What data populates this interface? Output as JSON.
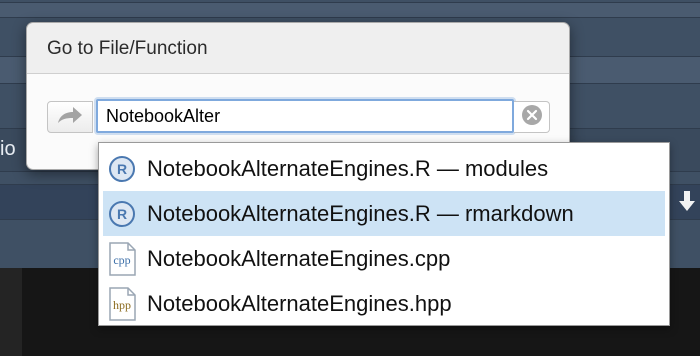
{
  "background": {
    "partial_text": "io",
    "down_arrow_icon": "arrow-down-icon"
  },
  "dialog": {
    "title": "Go to File/Function",
    "go_icon": "forward-arrow-icon",
    "clear_icon": "clear-circle-icon",
    "search": {
      "value": "NotebookAlter"
    },
    "suggestions": [
      {
        "label": "NotebookAlternateEngines.R — modules",
        "icon": "r-file-icon",
        "icon_text": "R",
        "selected": false
      },
      {
        "label": "NotebookAlternateEngines.R — rmarkdown",
        "icon": "r-file-icon",
        "icon_text": "R",
        "selected": true
      },
      {
        "label": "NotebookAlternateEngines.cpp",
        "icon": "cpp-file-icon",
        "icon_text": "cpp",
        "selected": false
      },
      {
        "label": "NotebookAlternateEngines.hpp",
        "icon": "hpp-file-icon",
        "icon_text": "hpp",
        "selected": false
      }
    ]
  },
  "colors": {
    "selection": "#cde3f5",
    "focus_ring": "#7fa9dd",
    "r_icon": "#4a78b0",
    "cpp_icon": "#3b6ea8",
    "hpp_icon": "#8a6a1e"
  }
}
